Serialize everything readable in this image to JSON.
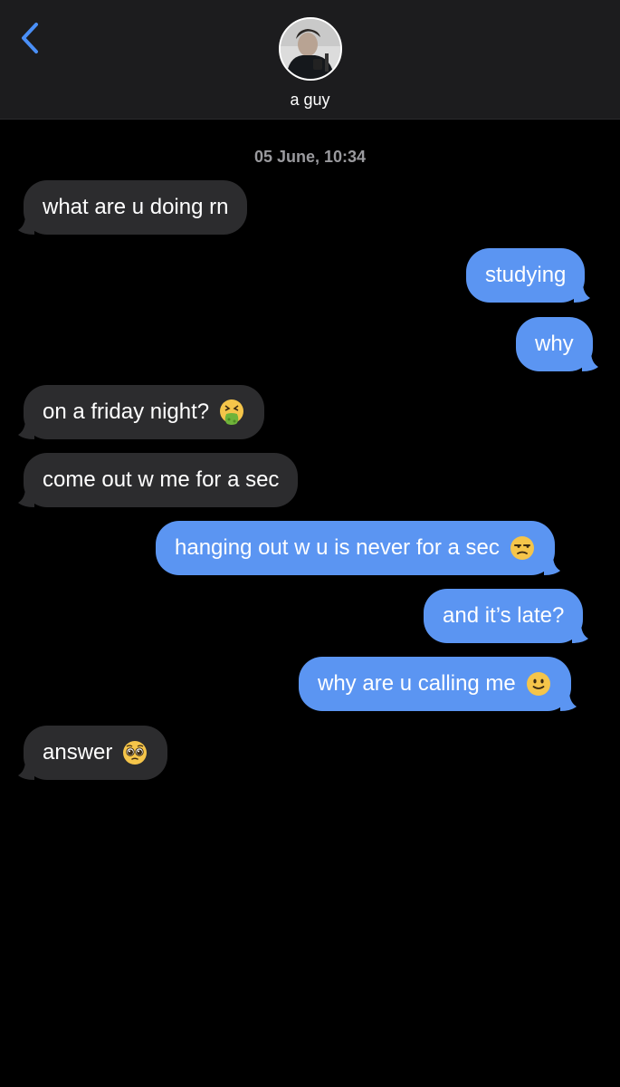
{
  "header": {
    "contact_name": "a guy",
    "back_icon": "chevron-left-icon",
    "avatar_icon": "contact-avatar"
  },
  "conversation": {
    "timestamp": "05 June, 10:34",
    "messages": [
      {
        "sender": "them",
        "text": "what are u doing rn",
        "emoji": ""
      },
      {
        "sender": "me",
        "text": "studying",
        "emoji": ""
      },
      {
        "sender": "me",
        "text": "why",
        "emoji": ""
      },
      {
        "sender": "them",
        "text": "on a friday night?",
        "emoji": "vomiting-face"
      },
      {
        "sender": "them",
        "text": "come out w me for a sec",
        "emoji": ""
      },
      {
        "sender": "me",
        "text": "hanging out w u is never for a sec",
        "emoji": "unamused-face"
      },
      {
        "sender": "me",
        "text": "and it’s late?",
        "emoji": ""
      },
      {
        "sender": "me",
        "text": "why are u calling me",
        "emoji": "slightly-smiling-face"
      },
      {
        "sender": "them",
        "text": "answer",
        "emoji": "pleading-face"
      }
    ]
  },
  "colors": {
    "background": "#000000",
    "header_bg": "#1c1c1e",
    "incoming_bubble": "#2c2c2e",
    "outgoing_bubble": "#5b95f2",
    "accent": "#4a8ff7",
    "timestamp": "#9a9a9e"
  }
}
